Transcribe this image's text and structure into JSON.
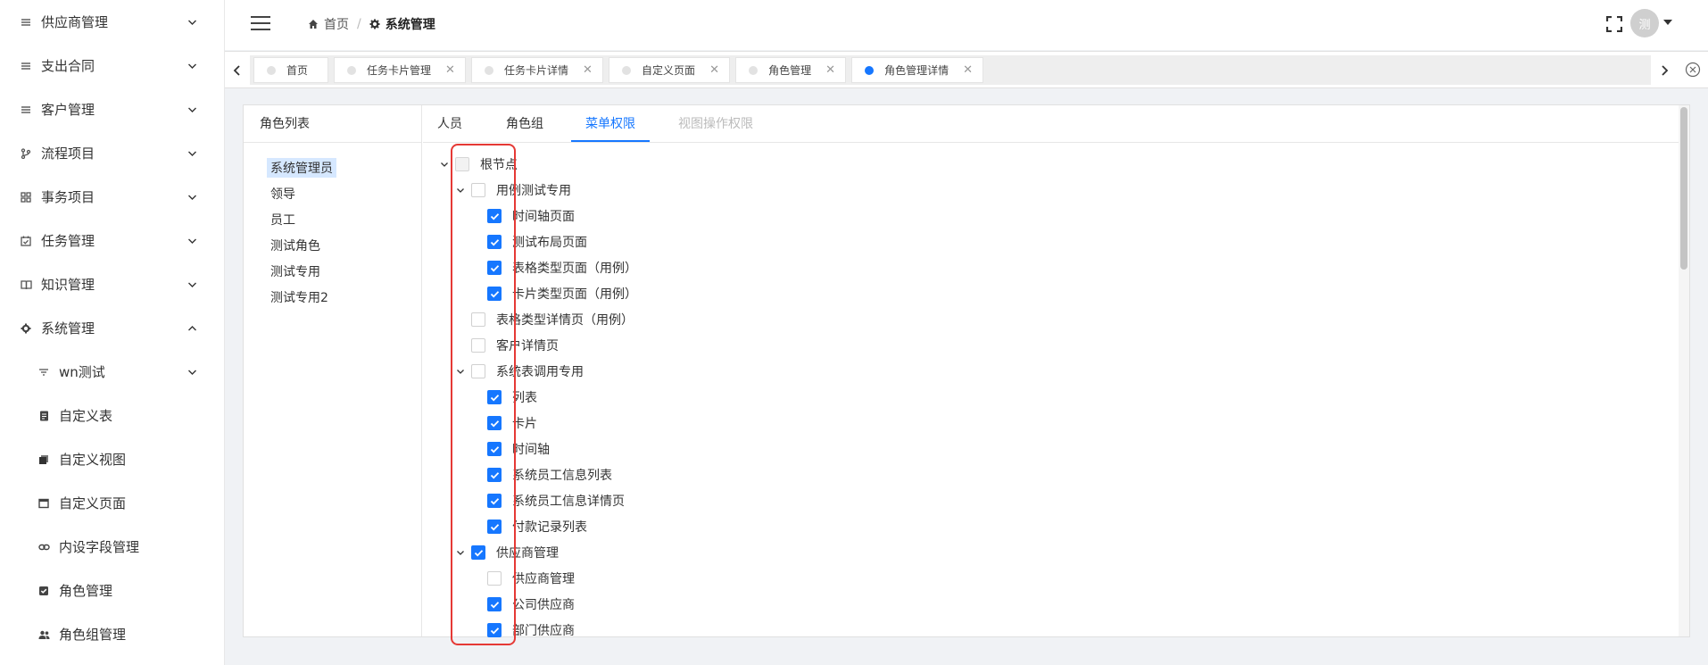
{
  "sidebar": {
    "items": [
      {
        "label": "供应商管理",
        "icon": "list-icon",
        "expanded": false
      },
      {
        "label": "支出合同",
        "icon": "list-icon",
        "expanded": false
      },
      {
        "label": "客户管理",
        "icon": "list-icon",
        "expanded": false
      },
      {
        "label": "流程项目",
        "icon": "branch-icon",
        "expanded": false
      },
      {
        "label": "事务项目",
        "icon": "grid-icon",
        "expanded": false
      },
      {
        "label": "任务管理",
        "icon": "calendar-check-icon",
        "expanded": false
      },
      {
        "label": "知识管理",
        "icon": "book-icon",
        "expanded": false
      },
      {
        "label": "系统管理",
        "icon": "gear-icon",
        "expanded": true
      }
    ],
    "sub_items": [
      {
        "label": "wn测试",
        "icon": "filter-icon",
        "has_arrow": true
      },
      {
        "label": "自定义表",
        "icon": "table-file-icon"
      },
      {
        "label": "自定义视图",
        "icon": "layers-icon"
      },
      {
        "label": "自定义页面",
        "icon": "window-icon"
      },
      {
        "label": "内设字段管理",
        "icon": "link-icon"
      },
      {
        "label": "角色管理",
        "icon": "checkbox-icon"
      },
      {
        "label": "角色组管理",
        "icon": "users-icon"
      }
    ]
  },
  "header": {
    "breadcrumb": {
      "home": "首页",
      "separator": "/",
      "current": "系统管理"
    },
    "avatar_text": "测"
  },
  "tabs": [
    {
      "label": "首页",
      "closable": false,
      "active": false
    },
    {
      "label": "任务卡片管理",
      "closable": true,
      "active": false
    },
    {
      "label": "任务卡片详情",
      "closable": true,
      "active": false
    },
    {
      "label": "自定义页面",
      "closable": true,
      "active": false
    },
    {
      "label": "角色管理",
      "closable": true,
      "active": false
    },
    {
      "label": "角色管理详情",
      "closable": true,
      "active": true
    }
  ],
  "tab_close_glyph": "✕",
  "role_list": {
    "title": "角色列表",
    "roles": [
      "系统管理员",
      "领导",
      "员工",
      "测试角色",
      "测试专用",
      "测试专用2"
    ],
    "selected_index": 0
  },
  "panel_tabs": [
    {
      "label": "人员",
      "state": "normal"
    },
    {
      "label": "角色组",
      "state": "normal"
    },
    {
      "label": "菜单权限",
      "state": "active"
    },
    {
      "label": "视图操作权限",
      "state": "disabled"
    }
  ],
  "tree": [
    {
      "label": "根节点",
      "level": 0,
      "caret": true,
      "state": "disabled"
    },
    {
      "label": "用例测试专用",
      "level": 1,
      "caret": true,
      "state": "unchecked"
    },
    {
      "label": "时间轴页面",
      "level": 2,
      "caret": false,
      "state": "checked"
    },
    {
      "label": "测试布局页面",
      "level": 2,
      "caret": false,
      "state": "checked"
    },
    {
      "label": "表格类型页面（用例）",
      "level": 2,
      "caret": false,
      "state": "checked"
    },
    {
      "label": "卡片类型页面（用例）",
      "level": 2,
      "caret": false,
      "state": "checked"
    },
    {
      "label": "表格类型详情页（用例）",
      "level": 1,
      "caret": false,
      "state": "unchecked"
    },
    {
      "label": "客户详情页",
      "level": 1,
      "caret": false,
      "state": "unchecked"
    },
    {
      "label": "系统表调用专用",
      "level": 1,
      "caret": true,
      "state": "unchecked"
    },
    {
      "label": "列表",
      "level": 2,
      "caret": false,
      "state": "checked"
    },
    {
      "label": "卡片",
      "level": 2,
      "caret": false,
      "state": "checked"
    },
    {
      "label": "时间轴",
      "level": 2,
      "caret": false,
      "state": "checked"
    },
    {
      "label": "系统员工信息列表",
      "level": 2,
      "caret": false,
      "state": "checked"
    },
    {
      "label": "系统员工信息详情页",
      "level": 2,
      "caret": false,
      "state": "checked"
    },
    {
      "label": "付款记录列表",
      "level": 2,
      "caret": false,
      "state": "checked"
    },
    {
      "label": "供应商管理",
      "level": 1,
      "caret": true,
      "state": "checked"
    },
    {
      "label": "供应商管理",
      "level": 2,
      "caret": false,
      "state": "unchecked"
    },
    {
      "label": "公司供应商",
      "level": 2,
      "caret": false,
      "state": "checked"
    },
    {
      "label": "部门供应商",
      "level": 2,
      "caret": false,
      "state": "checked"
    }
  ],
  "colors": {
    "accent": "#1677ff",
    "annotation": "#e53935",
    "selected_role_bg": "#d6e8ff"
  }
}
